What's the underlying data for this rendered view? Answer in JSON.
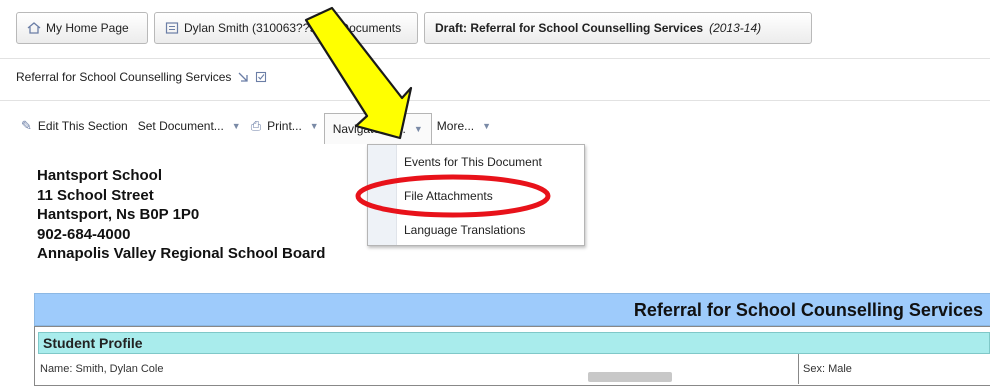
{
  "breadcrumb": {
    "home": "My Home Page",
    "student": "Dylan Smith (310063??98) > Documents",
    "draft_label": "Draft: Referral for School Counselling Services",
    "draft_year": "(2013-14)"
  },
  "document": {
    "title": "Referral for School Counselling Services"
  },
  "toolbar": {
    "edit": "Edit This Section",
    "set_document": "Set Document...",
    "print": "Print...",
    "navigate": "Navigate To...",
    "more": "More..."
  },
  "navigate_menu": {
    "items": [
      "Events for This Document",
      "File Attachments",
      "Language Translations"
    ]
  },
  "school": {
    "name": "Hantsport School",
    "street": "11 School Street",
    "city": "Hantsport, Ns B0P 1P0",
    "phone": "902-684-4000",
    "board": "Annapolis Valley Regional School Board"
  },
  "form": {
    "header": "Referral for School Counselling Services",
    "section": "Student Profile",
    "name_field": "Name: Smith, Dylan Cole",
    "sex_field": "Sex: Male"
  },
  "colors": {
    "form_header": "#9ecbfb",
    "section_header": "#a9ecec",
    "annotation_arrow": "#ffff00",
    "annotation_circle": "#e8121a"
  },
  "icons": [
    "home-icon",
    "document-icon",
    "pencil-icon",
    "printer-icon",
    "dropdown-arrow-icon"
  ]
}
